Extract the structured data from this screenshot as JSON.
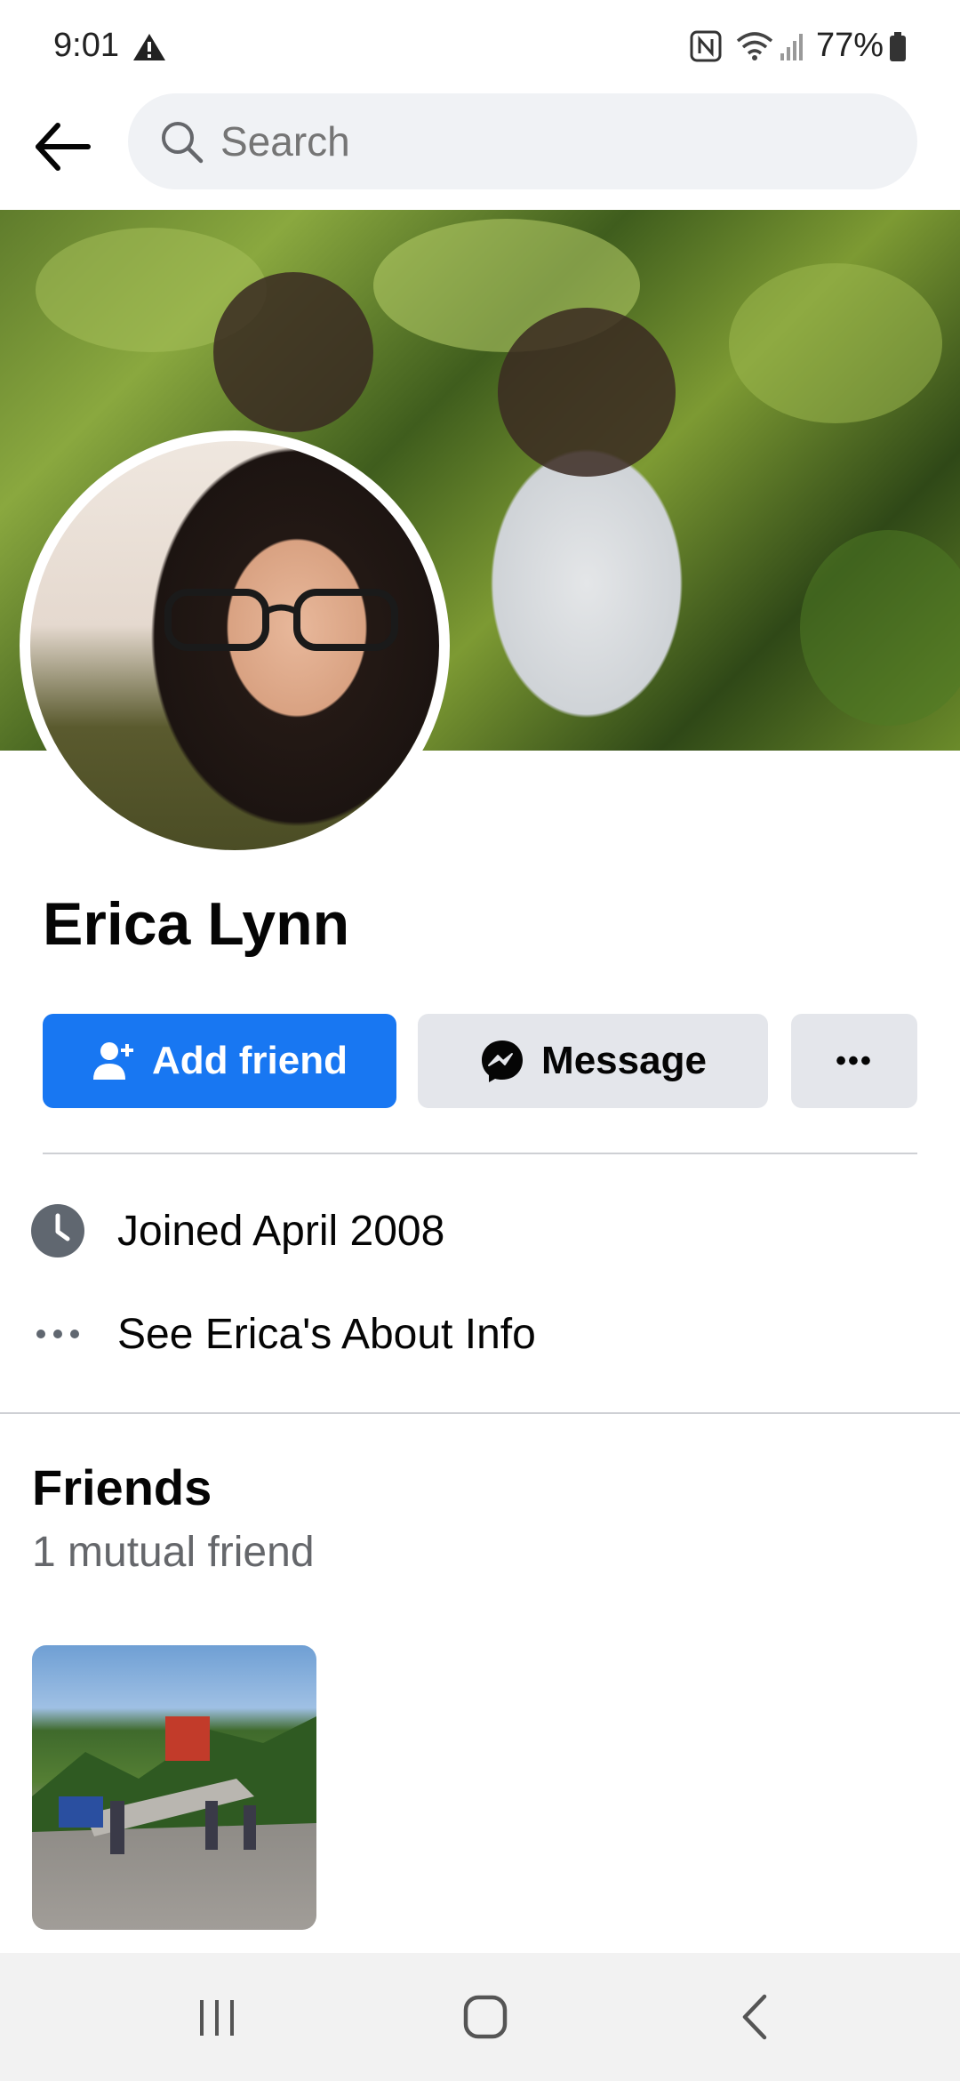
{
  "status_bar": {
    "time": "9:01",
    "battery": "77%"
  },
  "search": {
    "placeholder": "Search"
  },
  "profile": {
    "name": "Erica Lynn"
  },
  "actions": {
    "add_friend": "Add friend",
    "message": "Message",
    "more": "•••"
  },
  "info": {
    "joined": "Joined April 2008",
    "about": "See Erica's About Info"
  },
  "friends": {
    "title": "Friends",
    "mutual": "1 mutual friend"
  },
  "colors": {
    "primary_blue": "#1877f2",
    "secondary_button": "#e4e6eb",
    "search_bg": "#f0f2f5",
    "muted_text": "#65676b"
  }
}
